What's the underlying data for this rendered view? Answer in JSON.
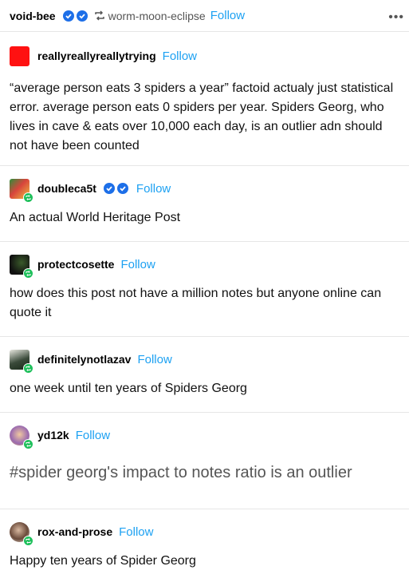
{
  "header": {
    "author": "void-bee",
    "reblogged_from": "worm-moon-eclipse",
    "follow_label": "Follow",
    "more_label": "•••"
  },
  "entries": [
    {
      "username": "reallyreallyreallytrying",
      "follow_label": "Follow",
      "text": "“average person eats 3 spiders a year” factoid actualy just statistical error. average person eats 0 spiders per year. Spiders Georg, who lives in cave & eats over 10,000 each day, is an outlier adn should not have been counted",
      "avatar_color": "#ff1111"
    },
    {
      "username": "doubleca5t",
      "follow_label": "Follow",
      "text": "An actual World Heritage Post",
      "avatar_color": "#d8443c"
    },
    {
      "username": "protectcosette",
      "follow_label": "Follow",
      "text": "how does this post not have a million notes but anyone online can quote it",
      "avatar_color": "#1c1c1c"
    },
    {
      "username": "definitelynotlazav",
      "follow_label": "Follow",
      "text": "one week until ten years of Spiders Georg",
      "avatar_color": "#3a4a3a"
    },
    {
      "username": "yd12k",
      "follow_label": "Follow",
      "tag": "#spider georg's impact to notes ratio is an outlier",
      "avatar_color": "#c9a0c0"
    },
    {
      "username": "rox-and-prose",
      "follow_label": "Follow",
      "text": "Happy ten years of Spider Georg",
      "avatar_color": "#6a4a3a"
    }
  ],
  "colors": {
    "follow": "#1da1f2",
    "verified": "#1d6fe8",
    "reblog_badge": "#20c05c"
  }
}
